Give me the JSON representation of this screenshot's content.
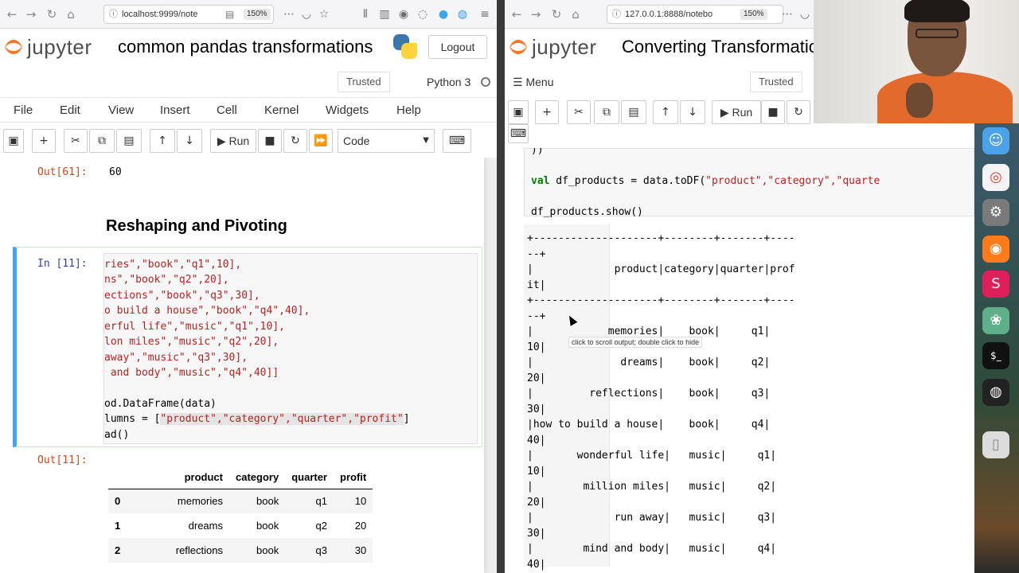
{
  "left": {
    "browser": {
      "url": "localhost:9999/note",
      "zoom": "150%"
    },
    "header": {
      "logo_text": "jupyter",
      "title": "common pandas transformations",
      "logout": "Logout"
    },
    "status": {
      "trusted": "Trusted",
      "kernel": "Python 3"
    },
    "menu": [
      "File",
      "Edit",
      "View",
      "Insert",
      "Cell",
      "Kernel",
      "Widgets",
      "Help"
    ],
    "toolbar": {
      "run": "Run",
      "cell_type": "Code"
    },
    "out61": {
      "prompt": "Out[61]:",
      "value": "60"
    },
    "heading": "Reshaping and Pivoting",
    "in11": {
      "prompt": "In [11]:"
    },
    "code_lines": [
      {
        "a": "ries\",",
        "b": "\"book\",\"q1\",10],"
      },
      {
        "a": "ns\",",
        "b": "\"book\",\"q2\",20],"
      },
      {
        "a": "ections\",",
        "b": "\"book\",\"q3\",30],"
      },
      {
        "a": "o build a house\",",
        "b": "\"book\",\"q4\",40],"
      },
      {
        "a": "erful life\",",
        "b": "\"music\",\"q1\",10],"
      },
      {
        "a": "lon miles\",",
        "b": "\"music\",\"q2\",20],"
      },
      {
        "a": "away\",",
        "b": "\"music\",\"q3\",30],"
      },
      {
        "a": " and body\",",
        "b": "\"music\",\"q4\",40]]"
      }
    ],
    "code_tail": {
      "l1": "od.DataFrame(data)",
      "l2a": "lumns = [",
      "l2b": "\"product\",\"category\",\"quarter\",\"profit\"",
      "l2c": "]",
      "l3": "ad()"
    },
    "out11": {
      "prompt": "Out[11]:"
    },
    "table": {
      "columns": [
        "",
        "product",
        "category",
        "quarter",
        "profit"
      ],
      "rows": [
        [
          "0",
          "memories",
          "book",
          "q1",
          "10"
        ],
        [
          "1",
          "dreams",
          "book",
          "q2",
          "20"
        ],
        [
          "2",
          "reflections",
          "book",
          "q3",
          "30"
        ]
      ]
    }
  },
  "right": {
    "browser": {
      "url": "127.0.0.1:8888/notebo",
      "zoom": "150%"
    },
    "header": {
      "logo_text": "jupyter",
      "title": "Converting Transformatic"
    },
    "status": {
      "menu": "Menu",
      "trusted": "Trusted"
    },
    "toolbar": {
      "run": "Run"
    },
    "code": {
      "l0": "))",
      "l1_kw": "val",
      "l1_rest": " df_products = data.toDF(",
      "l1_str": "\"product\",\"category\",\"quarte",
      "l2": "df_products.show()"
    },
    "output_lines": [
      "+--------------------+--------+-------+----",
      "--+",
      "|             product|category|quarter|prof",
      "it|",
      "+--------------------+--------+-------+----",
      "--+",
      "|            memories|    book|     q1|",
      "10|",
      "|              dreams|    book|     q2|",
      "20|",
      "|         reflections|    book|     q3|",
      "30|",
      "|how to build a house|    book|     q4|",
      "40|",
      "|       wonderful life|   music|     q1|",
      "10|",
      "|        million miles|   music|     q2|",
      "20|",
      "|             run away|   music|     q3|",
      "30|",
      "|        mind and body|   music|     q4|",
      "40|"
    ],
    "tooltip": "click to scroll output; double click to hide"
  }
}
